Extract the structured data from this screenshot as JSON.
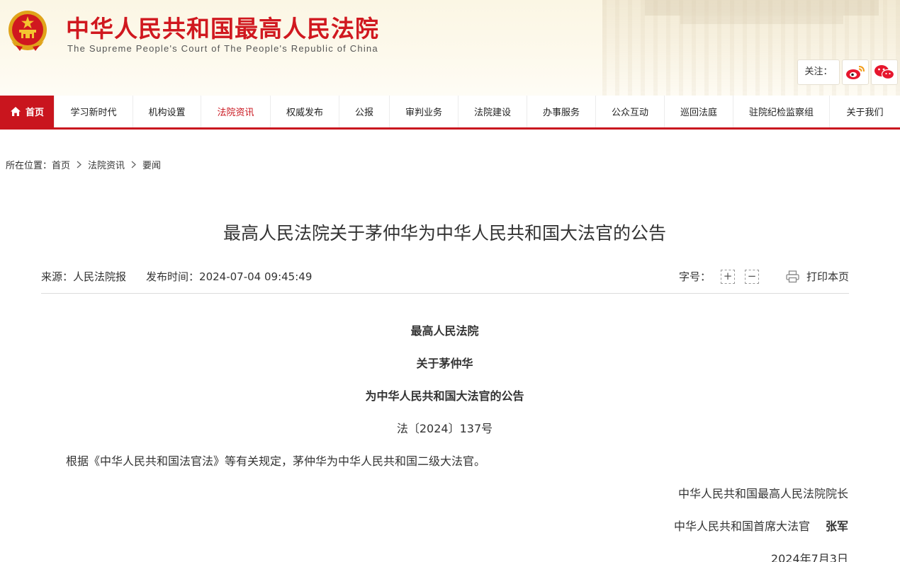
{
  "header": {
    "site_title": "中华人民共和国最高人民法院",
    "site_subtitle": "The Supreme People's Court of The People's Republic of China",
    "follow_label": "关注：",
    "emblem_icon": "national-emblem-icon",
    "social": [
      {
        "icon": "weibo-icon"
      },
      {
        "icon": "wechat-icon"
      }
    ]
  },
  "nav": {
    "items": [
      {
        "label": "首页",
        "icon": "home-icon"
      },
      {
        "label": "学习新时代"
      },
      {
        "label": "机构设置"
      },
      {
        "label": "法院资讯"
      },
      {
        "label": "权威发布"
      },
      {
        "label": "公报"
      },
      {
        "label": "审判业务"
      },
      {
        "label": "法院建设"
      },
      {
        "label": "办事服务"
      },
      {
        "label": "公众互动"
      },
      {
        "label": "巡回法庭"
      },
      {
        "label": "驻院纪检监察组"
      },
      {
        "label": "关于我们"
      }
    ],
    "active_index": 3,
    "accent_color": "#c9151e"
  },
  "breadcrumb": {
    "prefix": "所在位置：",
    "items": [
      "首页",
      "法院资讯",
      "要闻"
    ]
  },
  "article": {
    "title": "最高人民法院关于茅仲华为中华人民共和国大法官的公告",
    "source_label": "来源：",
    "source": "人民法院报",
    "time_label": "发布时间：",
    "time": "2024-07-04 09:45:49",
    "fontsize_label": "字号：",
    "increase_symbol": "+",
    "decrease_symbol": "−",
    "print_label": "打印本页",
    "heading_1": "最高人民法院",
    "heading_2": "关于茅仲华",
    "heading_3": "为中华人民共和国大法官的公告",
    "doc_number": "法〔2024〕137号",
    "paragraph": "根据《中华人民共和国法官法》等有关规定，茅仲华为中华人民共和国二级大法官。",
    "signer_title_1": "中华人民共和国最高人民法院院长",
    "signer_title_2": "中华人民共和国首席大法官",
    "signer_name": "张军",
    "date": "2024年7月3日"
  }
}
